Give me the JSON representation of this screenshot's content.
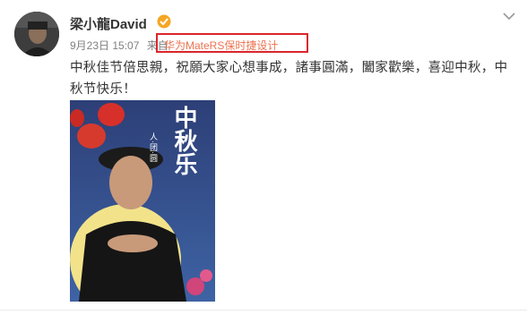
{
  "post": {
    "author_name": "梁小龍David",
    "timestamp": "9月23日 15:07",
    "via_label": "来自",
    "device": "华为MateRS保时捷设计",
    "text": "中秋佳节倍思親，祝願大家心想事成，諸事圓滿，闔家歡樂，喜迎中秋，中秋节快乐！",
    "photo_caption_main": "中秋乐",
    "photo_caption_sub": "人·团·圆"
  },
  "colors": {
    "verified_badge": "#f5a623",
    "device_highlight_border": "#d9262c",
    "link_color": "#eb7350"
  },
  "icons": {
    "verified": "verified-badge-icon",
    "menu": "chevron-down-icon"
  }
}
